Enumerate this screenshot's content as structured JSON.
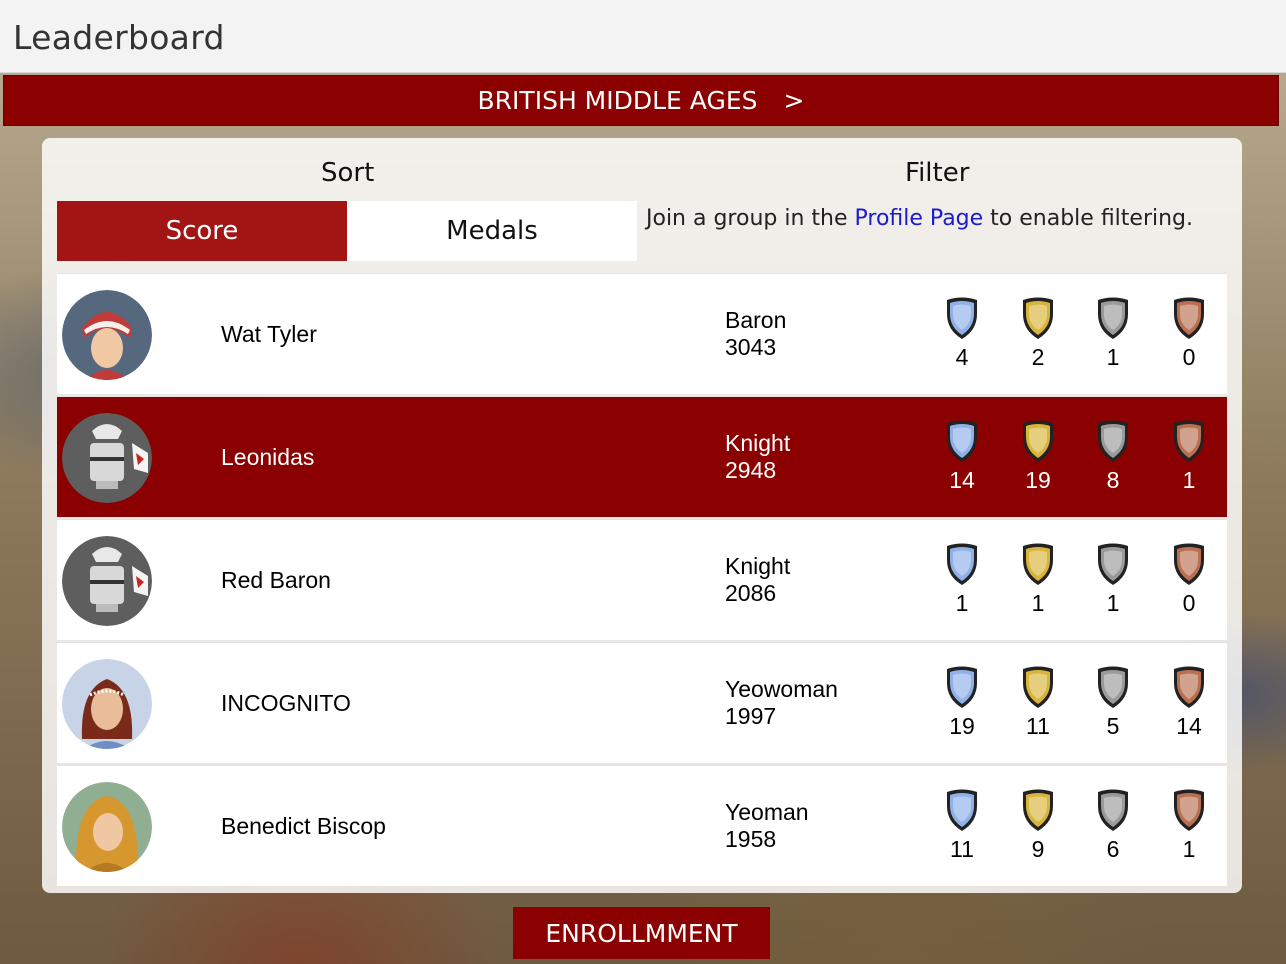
{
  "window": {
    "title": "Leaderboard"
  },
  "era": {
    "label": "BRITISH MIDDLE AGES",
    "chevron": ">"
  },
  "sort": {
    "label": "Sort",
    "options": [
      "Score",
      "Medals"
    ],
    "selected": "Score"
  },
  "filter": {
    "label": "Filter",
    "note_prefix": "Join a group in the ",
    "note_link": "Profile Page",
    "note_suffix": " to enable filtering."
  },
  "players": [
    {
      "name": "Wat Tyler",
      "rank": "Baron",
      "score": "3043",
      "avatar": "woman-headdress-avatar",
      "medals": [
        "4",
        "2",
        "1",
        "0"
      ],
      "highlight": false
    },
    {
      "name": "Leonidas",
      "rank": "Knight",
      "score": "2948",
      "avatar": "knight-helmet-avatar",
      "medals": [
        "14",
        "19",
        "8",
        "1"
      ],
      "highlight": true
    },
    {
      "name": "Red Baron",
      "rank": "Knight",
      "score": "2086",
      "avatar": "knight-helmet-avatar",
      "medals": [
        "1",
        "1",
        "1",
        "0"
      ],
      "highlight": false
    },
    {
      "name": "INCOGNITO",
      "rank": "Yeowoman",
      "score": "1997",
      "avatar": "woman-circlet-avatar",
      "medals": [
        "19",
        "11",
        "5",
        "14"
      ],
      "highlight": false
    },
    {
      "name": "Benedict Biscop",
      "rank": "Yeoman",
      "score": "1958",
      "avatar": "monk-hood-avatar",
      "medals": [
        "11",
        "9",
        "6",
        "1"
      ],
      "highlight": false
    }
  ],
  "medal_types": [
    "platinum-shield-icon",
    "gold-shield-icon",
    "silver-shield-icon",
    "bronze-shield-icon"
  ],
  "colors": {
    "accent": "#8b0000",
    "platinum": "#8fb0e8",
    "gold": "#d8b43a",
    "silver": "#9a9a9a",
    "bronze": "#b87050"
  },
  "footer": {
    "enroll_label": "ENROLLMMENT"
  }
}
